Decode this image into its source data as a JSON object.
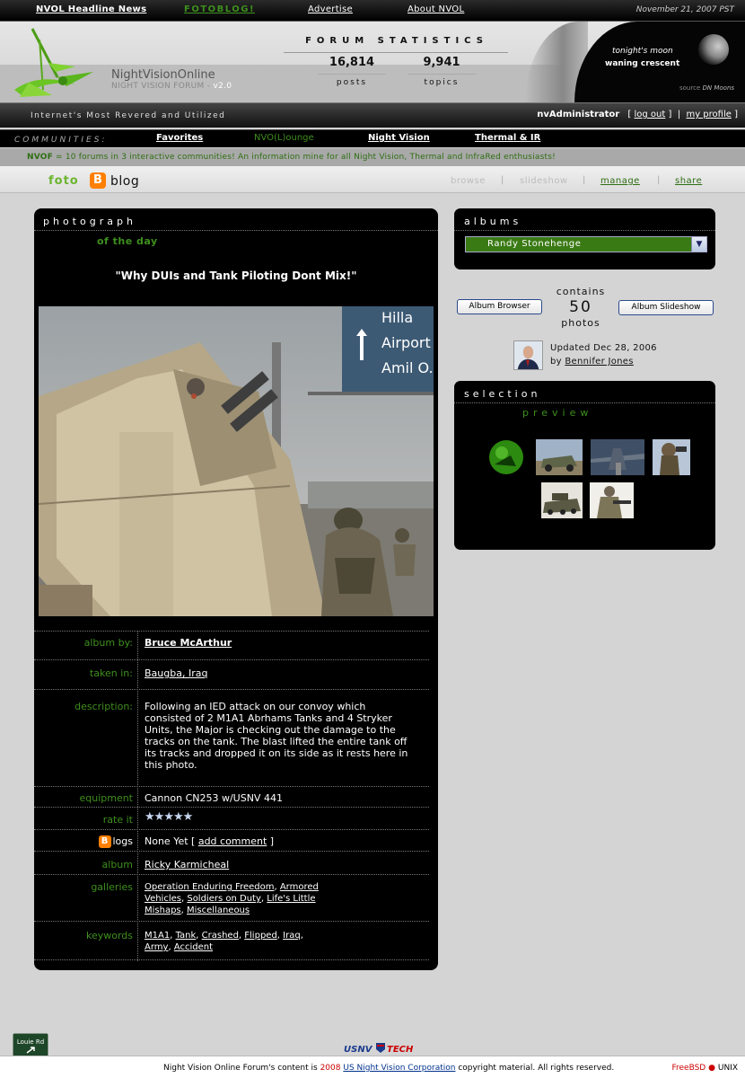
{
  "topbar": {
    "headline": "NVOL Headline News",
    "fotoblog": "FOTOBLOG!",
    "advertise": "Advertise",
    "about": "About NVOL",
    "date": "November 21, 2007 PST"
  },
  "header": {
    "site_name": "NightVisionOnline",
    "site_sub": "NIGHT VISION FORUM - ",
    "version": "v2.0",
    "stats_title": "FORUM STATISTICS",
    "posts_count": "16,814",
    "posts_label": "posts",
    "topics_count": "9,941",
    "topics_label": "topics",
    "moon_label": "tonight's moon",
    "moon_phase": "waning crescent",
    "moon_source": "source",
    "moon_source_name": "DN Moons"
  },
  "userbar": {
    "tagline": "Internet's Most Revered and Utilized",
    "username": "nvAdministrator",
    "logout": "log out",
    "profile": "my profile"
  },
  "communities": {
    "label": "COMMUNITIES:",
    "items": [
      "Favorites",
      "NVO(L)ounge",
      "Night Vision",
      "Thermal & IR"
    ]
  },
  "infobar": {
    "brand": "NVOF",
    "text": " = 10 forums in 3 interactive communities! An information mine for all Night Vision, Thermal and InfraRed enthusiasts!"
  },
  "blognav": {
    "foto": "foto",
    "blog": "blog",
    "browse": "browse",
    "slideshow": "slideshow",
    "manage": "manage",
    "share": "share"
  },
  "photo_panel": {
    "title": "photograph",
    "subtitle": "of the day",
    "caption": "\"Why DUIs and Tank Piloting Dont Mix!\"",
    "album_by_label": "album by:",
    "album_by": "Bruce McArthur",
    "taken_label": "taken in:",
    "taken": "Baugba, Iraq",
    "desc_label": "description:",
    "description": "Following an IED attack on our convoy which consisted of 2 M1A1 Abrhams Tanks and 4 Stryker Units, the Major is checking out the damage to the tracks on the tank. The blast lifted the entire tank off its tracks and dropped it on its side as it rests here in this photo.",
    "equipment_label": "equipment",
    "equipment": "Cannon CN253 w/USNV 441",
    "rate_label": "rate it",
    "rating": 5,
    "blogs_label": "logs",
    "blogs_value": "None Yet [",
    "add_comment": "add comment",
    "blogs_close": "]",
    "album_label": "album",
    "album": "Ricky Karmicheal",
    "galleries_label": "galleries",
    "galleries": [
      "Operation Enduring Freedom",
      "Armored Vehicles",
      "Soldiers on Duty",
      "Life's Little Mishaps",
      "Miscellaneous"
    ],
    "keywords_label": "keywords",
    "keywords": [
      "M1A1",
      "Tank",
      "Crashed",
      "Flipped",
      "Iraq",
      "Army",
      "Accident"
    ]
  },
  "albums_panel": {
    "title": "albums",
    "selected": "Randy Stonehenge"
  },
  "album_info": {
    "browser_btn": "Album Browser",
    "slideshow_btn": "Album Slideshow",
    "contains": "contains",
    "count": "50",
    "photos": "photos",
    "updated": "Updated Dec 28, 2006",
    "by": "by",
    "author": "Bennifer Jones"
  },
  "selection_panel": {
    "title": "selection",
    "preview": "preview"
  },
  "footer": {
    "text1": "Night Vision Online Forum's content is ",
    "year": "2008",
    "company": "US Night Vision Corporation",
    "text2": " copyright material. All rights reserved.",
    "freebsd": "FreeBSD",
    "unix": "UNIX",
    "usnv": "USNV",
    "tech": "TECH",
    "louie": "Louie Rd"
  },
  "colors": {
    "accent_green": "#3e8f1e",
    "panel_bg": "#000000",
    "blogger_orange": "#ff7f00"
  }
}
